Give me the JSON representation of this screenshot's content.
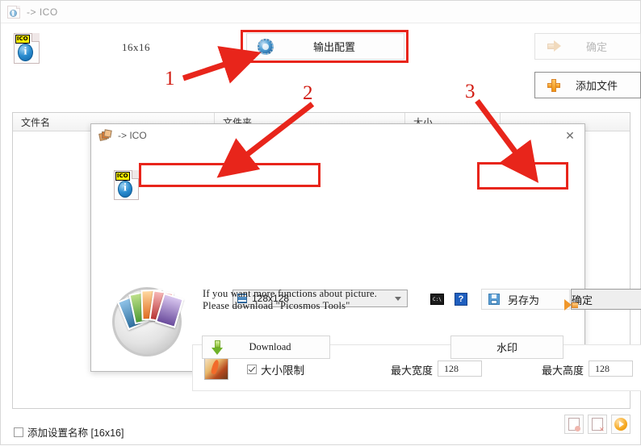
{
  "window": {
    "title": "-> ICO",
    "icon": "app-icon"
  },
  "toolbar": {
    "size_label": "16x16",
    "output_config_label": "输出配置",
    "confirm_label": "确定",
    "add_file_label": "添加文件"
  },
  "file_list": {
    "columns": [
      "文件名",
      "文件夹",
      "大小",
      ""
    ],
    "rows": []
  },
  "bottom": {
    "add_setting_name_label": "添加设置名称 [16x16]",
    "add_setting_name_checked": false,
    "buttons": [
      "add-file-mini",
      "remove-file-mini",
      "start-mini"
    ]
  },
  "dialog": {
    "title": "-> ICO",
    "close_label": "✕",
    "size_select_value": "128x128",
    "cmd_label": "C:\\",
    "help_label": "?",
    "save_as_label": "另存为",
    "confirm_label": "确定",
    "options": {
      "size_limit_label": "大小限制",
      "size_limit_checked": true,
      "max_width_label": "最大宽度",
      "max_width_value": "128",
      "max_height_label": "最大高度",
      "max_height_value": "128"
    },
    "promo": {
      "text": "If you want more functions about picture.\nPlease download \"Picosmos Tools\"",
      "download_label": "Download",
      "watermark_label": "水印"
    }
  },
  "annotations": {
    "markers": [
      "1",
      "2",
      "3"
    ],
    "color": "#d11a10"
  }
}
